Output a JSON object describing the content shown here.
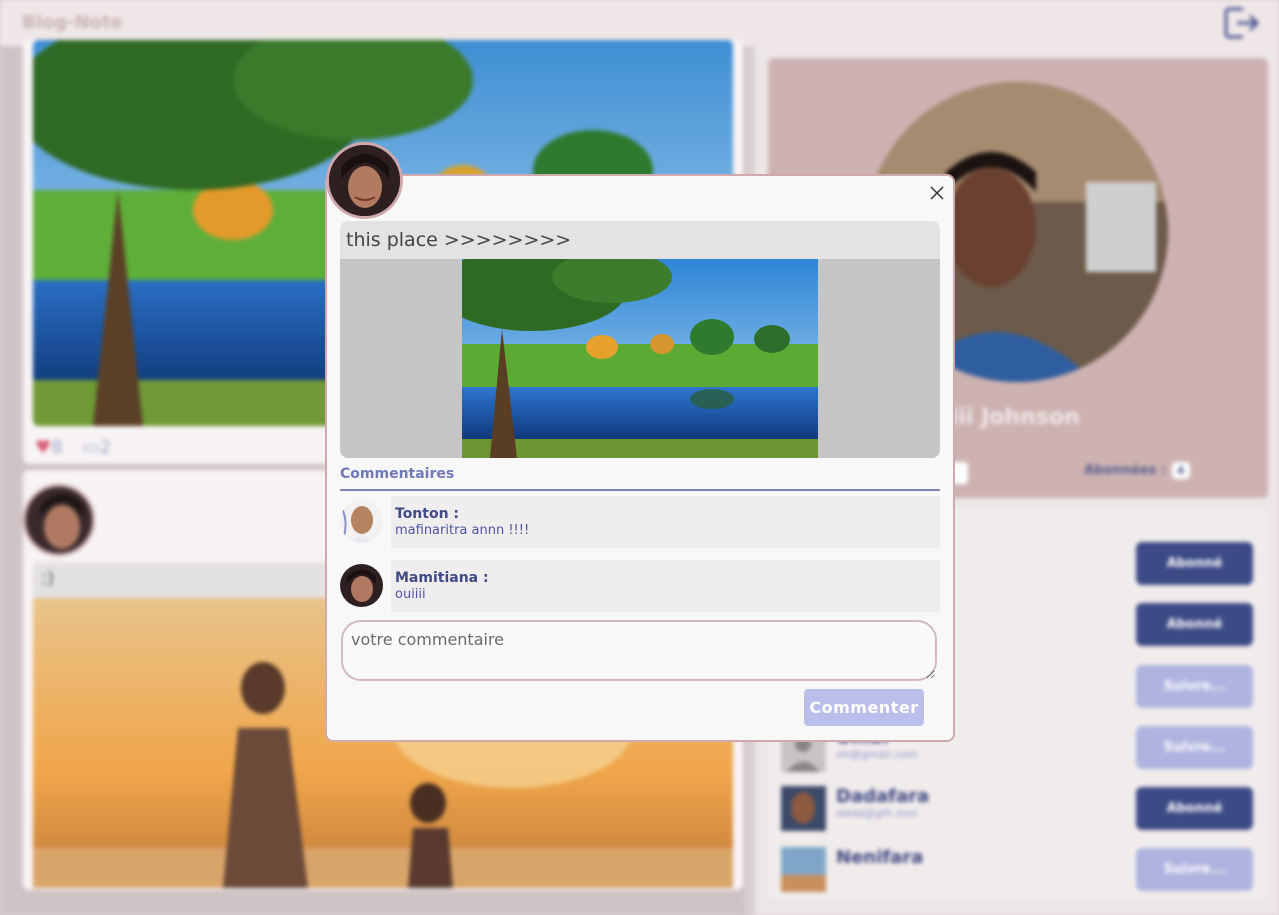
{
  "app": {
    "title": "Blog-Note"
  },
  "feed": {
    "post1": {
      "likes": "8",
      "comments": "2"
    },
    "post2": {
      "caption": ":)"
    }
  },
  "profile": {
    "name": "Nii Johnson",
    "subscribers_label": "Abonnées :",
    "subscribers_count": "4"
  },
  "users": [
    {
      "button": "Abonné",
      "state": "subscribed"
    },
    {
      "button": "Abonné",
      "state": "subscribed"
    },
    {
      "button": "Suivre...",
      "state": "not-subscribed"
    },
    {
      "name": "Omar",
      "email": "oh@gmail.com",
      "button": "Suivre...",
      "state": "not-subscribed"
    },
    {
      "name": "Dadafara",
      "email": "dddd@gfh.mm",
      "button": "Abonné",
      "state": "subscribed"
    },
    {
      "name": "Nenifara",
      "email": "",
      "button": "Suivre...",
      "state": "not-subscribed"
    }
  ],
  "modal": {
    "caption": "this place >>>>>>>>",
    "comments_title": "Commentaires",
    "comments": [
      {
        "author": "Tonton :",
        "text": "mafinaritra annn !!!!"
      },
      {
        "author": "Mamitiana :",
        "text": "ouiiii"
      }
    ],
    "input_placeholder": "votre commentaire",
    "submit_label": "Commenter"
  },
  "colors": {
    "accent": "#3c4a86",
    "accent_light": "#aeb4df",
    "rose_border": "#cfa9ab",
    "like": "#d9607a"
  }
}
